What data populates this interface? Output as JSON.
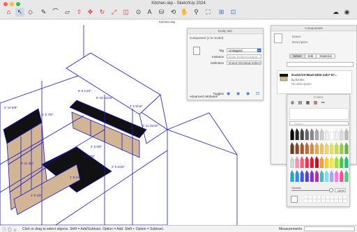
{
  "window": {
    "title": "Kitchen.skp - SketchUp 2024",
    "doc_tab": "Kitchen.skp"
  },
  "colors_ui": {
    "accent": "#2a6fd1",
    "model_line": "#1a18d8",
    "cabinet_fill": "#d2b592"
  },
  "toolbar": {
    "tools": [
      "house-icon",
      "select-arrow-icon",
      "eraser-icon",
      "pencil-icon",
      "arc-icon",
      "shapes-icon",
      "push-pull-icon",
      "move-icon",
      "rotate-icon",
      "scale-icon",
      "offset-icon",
      "tape-measure-icon",
      "text-icon",
      "paint-bucket-icon",
      "orbit-icon",
      "pan-icon",
      "zoom-icon",
      "zoom-extents-icon",
      "warehouse-icon",
      "extension-icon",
      "cloud-icon",
      "account-icon",
      "layout-icon"
    ]
  },
  "entity_info": {
    "title": "Entity Info",
    "header": "Component (1 in model)",
    "tag_label": "Tag",
    "tag_value": "Untagged",
    "instance_label": "Instance",
    "instance_placeholder": "Enter instance name",
    "definition_label": "Definition",
    "definition_value": "9ca04723-85ad-42b0-a",
    "toggles_label": "Toggles",
    "advanced_label": "Advanced Attributes"
  },
  "components": {
    "title": "Components",
    "name_placeholder": "Name",
    "description_placeholder": "Description",
    "tabs": [
      {
        "label": "Select",
        "active": true
      },
      {
        "label": "Edit",
        "active": false
      },
      {
        "label": "Statistics",
        "active": false
      }
    ],
    "item": {
      "name": "9ca04723-85ad-42b0-aeb7-57...",
      "author": "by Emlex",
      "description": "No description"
    }
  },
  "colors_panel": {
    "title": "Colors",
    "search_placeholder": "Search",
    "opacity_label": "Opacity",
    "opacity_value": "100%",
    "opacity_fraction": 1.0
  },
  "status": {
    "message": "Click or drag to select objects. Shift = Add/Subtract. Option = Add. Shift + Option = Subtract.",
    "measurements_label": "Measurements"
  },
  "model_labels": [
    "8' 10 15/16\"",
    "2' 5 5/16\"",
    "8' 9 1/16\"",
    "0' 11 15/16\"",
    "2' 10 5/8\"",
    "2' 9 7/8\"",
    "3' 3 5/8\"",
    "2' 5 5/16\"",
    "0' 11 3/8\"",
    "1' 6 1/4\"",
    "1' 6 1/8\"",
    "0' 6 7/8\""
  ]
}
